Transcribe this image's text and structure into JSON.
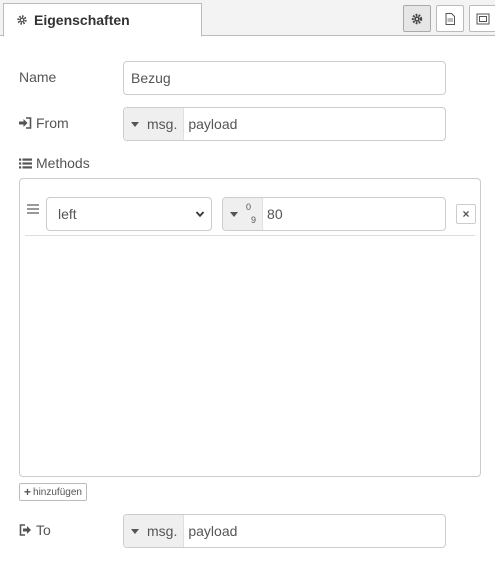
{
  "tab": {
    "title": "Eigenschaften"
  },
  "tab_buttons": [
    {
      "icon": "gear-icon",
      "active": true
    },
    {
      "icon": "document-icon",
      "active": false
    },
    {
      "icon": "frame-icon",
      "active": false
    }
  ],
  "name": {
    "label": "Name",
    "value": "Bezug"
  },
  "from": {
    "label": "From",
    "type_prefix": "msg.",
    "value": "payload"
  },
  "methods": {
    "label": "Methods",
    "rows": [
      {
        "method": "left",
        "type_prefix_top": "0",
        "type_prefix_bottom": "9",
        "value": "80"
      }
    ],
    "add_label": "hinzufügen",
    "remove_label": "×"
  },
  "to": {
    "label": "To",
    "type_prefix": "msg.",
    "value": "payload"
  }
}
